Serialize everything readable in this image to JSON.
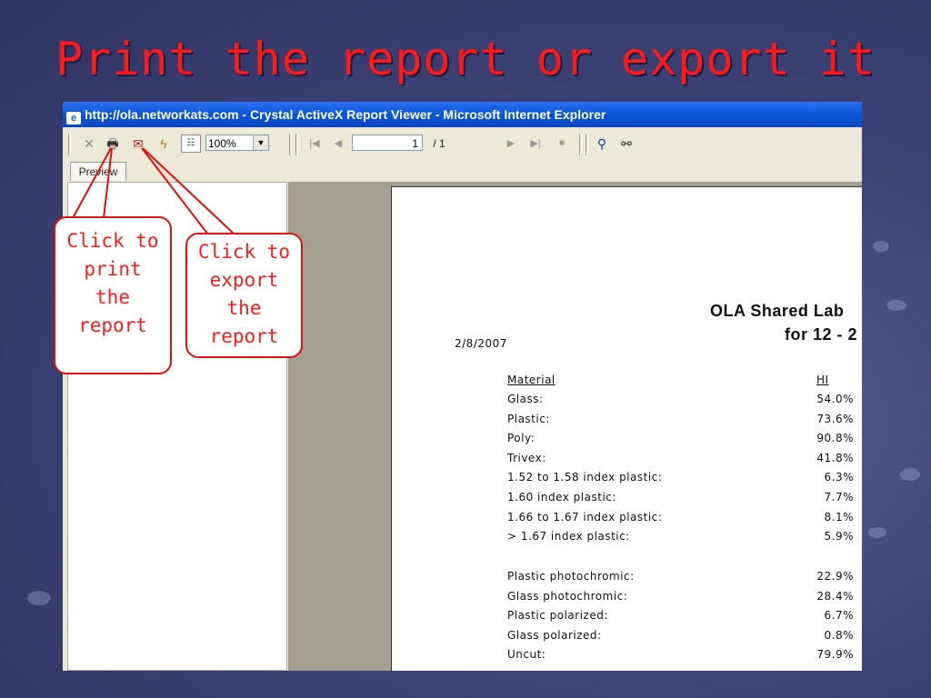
{
  "slide": {
    "title": "Print the report or export it"
  },
  "window": {
    "title": "http://ola.networkats.com - Crystal ActiveX Report Viewer - Microsoft Internet Explorer"
  },
  "toolbar": {
    "zoom_value": "100%",
    "page_value": "1",
    "page_total": "/ 1"
  },
  "tabs": {
    "preview_label": "Preview"
  },
  "report": {
    "title_line1": "OLA Shared Lab",
    "title_line2": "for 12 - 2",
    "date": "2/8/2007",
    "header_material": "Material",
    "header_hi": "HI",
    "rows_a": [
      {
        "label": "Glass:",
        "value": "54.0%"
      },
      {
        "label": "Plastic:",
        "value": "73.6%"
      },
      {
        "label": "Poly:",
        "value": "90.8%"
      },
      {
        "label": "Trivex:",
        "value": "41.8%"
      },
      {
        "label": "1.52 to 1.58 index plastic:",
        "value": "6.3%"
      },
      {
        "label": "1.60 index plastic:",
        "value": "7.7%"
      },
      {
        "label": "1.66 to 1.67 index plastic:",
        "value": "8.1%"
      },
      {
        "label": "> 1.67 index plastic:",
        "value": "5.9%"
      }
    ],
    "rows_b": [
      {
        "label": "Plastic photochromic:",
        "value": "22.9%"
      },
      {
        "label": "Glass photochromic:",
        "value": "28.4%"
      },
      {
        "label": "Plastic polarized:",
        "value": "6.7%"
      },
      {
        "label": "Glass polarized:",
        "value": "0.8%"
      },
      {
        "label": "Uncut:",
        "value": "79.9%"
      }
    ]
  },
  "callouts": {
    "print": [
      "Click to",
      "print",
      "the",
      "report"
    ],
    "export": [
      "Click to",
      "export",
      "the",
      "report"
    ]
  },
  "colors": {
    "accent": "#ff1a1a",
    "titlebar": "#0a55d8"
  },
  "icons": [
    "close-icon",
    "print-icon",
    "export-icon",
    "refresh-icon",
    "group-tree-icon",
    "first-page-icon",
    "prev-page-icon",
    "next-page-icon",
    "last-page-icon",
    "stop-icon",
    "search-icon"
  ]
}
